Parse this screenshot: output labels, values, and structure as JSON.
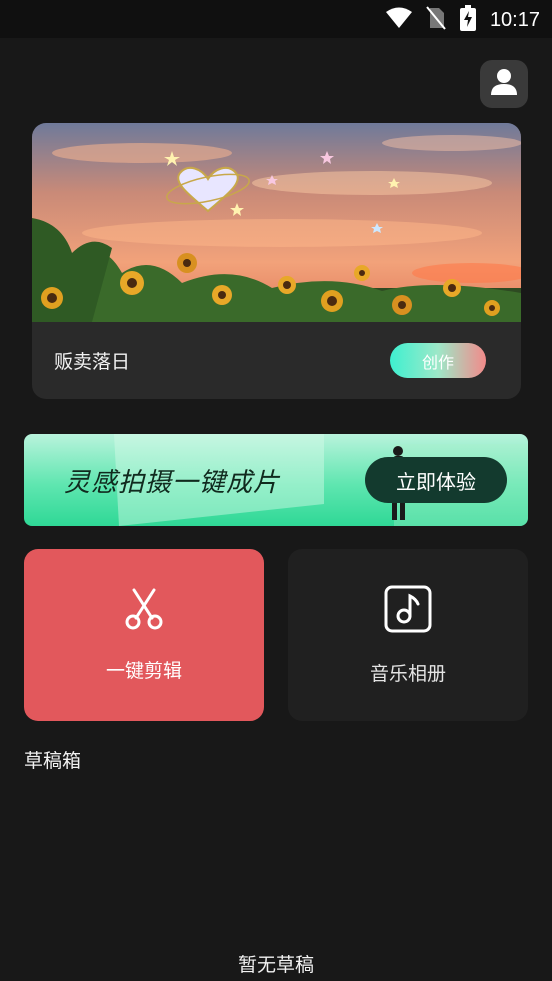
{
  "status_bar": {
    "time": "10:17",
    "icons": [
      "wifi-icon",
      "no-sim-icon",
      "battery-charging-icon"
    ]
  },
  "header": {
    "profile_icon": "user-icon"
  },
  "hero": {
    "title": "贩卖落日",
    "create_label": "创作"
  },
  "banner": {
    "slogan": "灵感拍摄一键成片",
    "cta_label": "立即体验"
  },
  "tools": {
    "one_click_edit": {
      "label": "一键剪辑",
      "icon": "scissors-icon"
    },
    "music_album": {
      "label": "音乐相册",
      "icon": "music-note-icon"
    }
  },
  "drafts": {
    "title": "草稿箱",
    "empty_text": "暂无草稿"
  },
  "colors": {
    "background": "#181818",
    "accent_red": "#e2585c",
    "banner_green": "#5fe6b0"
  }
}
